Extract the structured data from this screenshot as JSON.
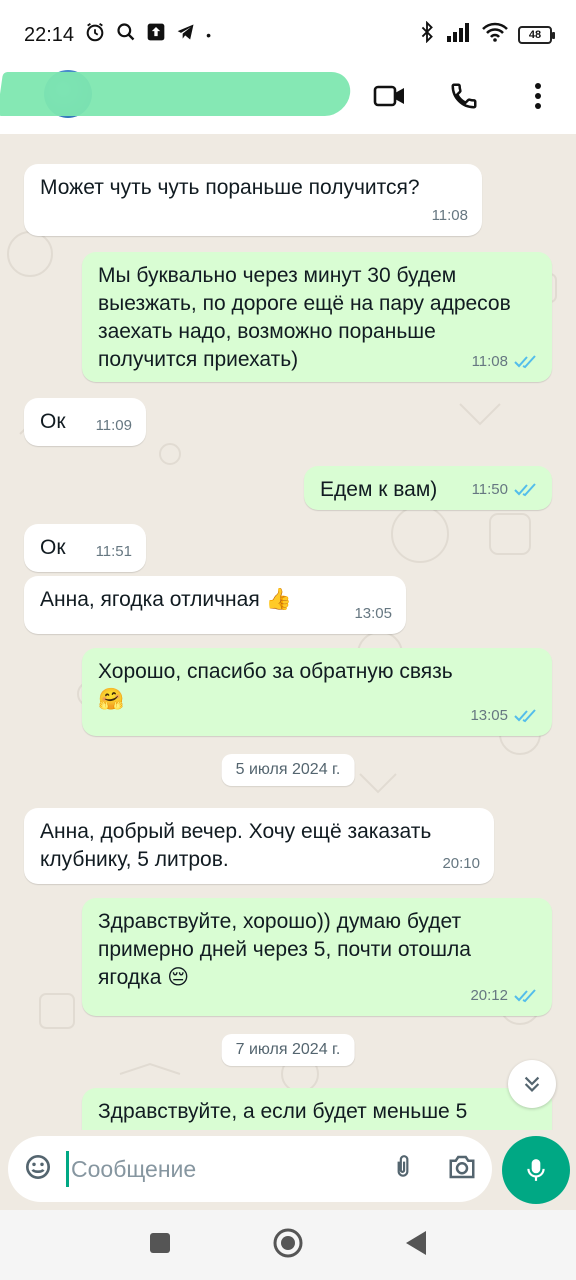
{
  "status_bar": {
    "time": "22:14",
    "battery": "48",
    "icons": [
      "alarm-icon",
      "search-icon",
      "upload-icon",
      "telegram-icon",
      "bluetooth-icon",
      "signal-icon",
      "wifi-icon"
    ]
  },
  "header": {
    "icons": [
      "video-call-icon",
      "voice-call-icon",
      "more-options-icon"
    ]
  },
  "messages": [
    {
      "text": "Может чуть чуть пораньше получится?",
      "time": "11:08",
      "dir": "in"
    },
    {
      "text": "Мы буквально через минут 30 будем выезжать, по дороге ещё на пару адресов заехать надо, возможно пораньше получится приехать)",
      "time": "11:08",
      "dir": "out"
    },
    {
      "text": "Ок",
      "time": "11:09",
      "dir": "in"
    },
    {
      "text": "Едем к вам)",
      "time": "11:50",
      "dir": "out"
    },
    {
      "text": "Ок",
      "time": "11:51",
      "dir": "in"
    },
    {
      "text": "Анна, ягодка отличная",
      "emoji": "👍",
      "time": "13:05",
      "dir": "in"
    },
    {
      "text": "Хорошо, спасибо за обратную связь",
      "emoji": "🤗",
      "time": "13:05",
      "dir": "out"
    },
    {
      "text": "Анна, добрый вечер. Хочу ещё заказать клубнику, 5 литров.",
      "time": "20:10",
      "dir": "in"
    },
    {
      "text": "Здравствуйте, хорошо)) думаю будет примерно дней через 5, почти отошла ягодка",
      "emoji": "😔",
      "time": "20:12",
      "dir": "out"
    },
    {
      "text": "Здравствуйте, а если будет меньше 5",
      "time": "",
      "dir": "out"
    }
  ],
  "date_chips": [
    "5 июля 2024 г.",
    "7 июля 2024 г."
  ],
  "input": {
    "placeholder": "Сообщение",
    "icons": [
      "emoji-sticker-icon",
      "attach-icon",
      "camera-icon",
      "mic-icon"
    ]
  },
  "colors": {
    "outgoing_bubble": "#d9fdd3",
    "incoming_bubble": "#ffffff",
    "chat_background": "#efeae2",
    "accent": "#00a884",
    "read_ticks": "#53bdeb",
    "name_redaction": "#7ee7b0"
  }
}
